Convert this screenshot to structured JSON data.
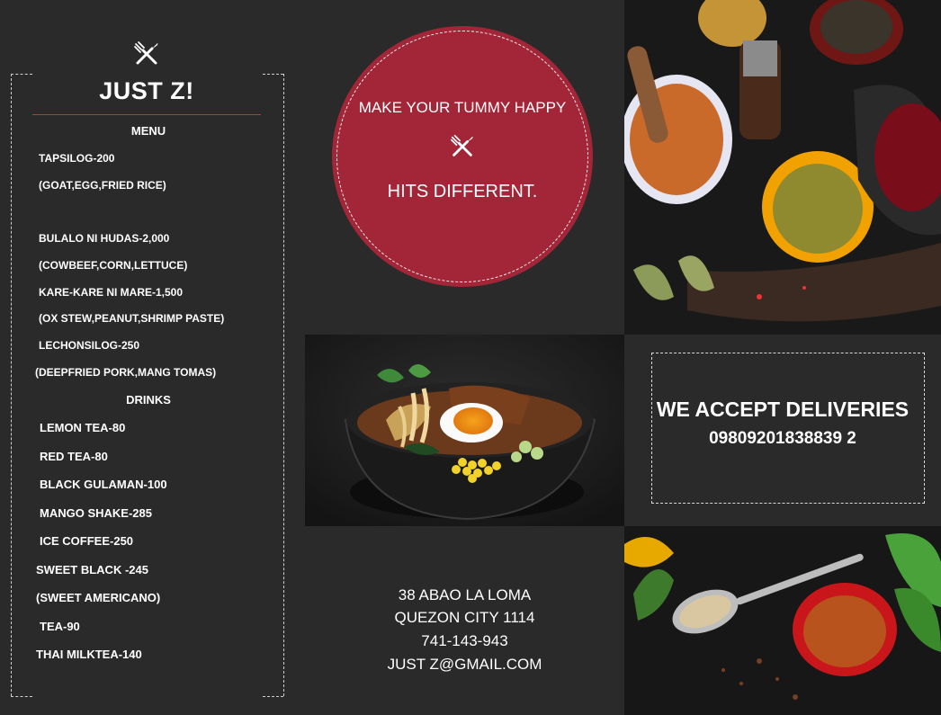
{
  "brand": {
    "name": "JUST Z!",
    "logo_icon": "fork-knife-icon"
  },
  "menu": {
    "heading": "MENU",
    "lines": [
      "TAPSILOG-200",
      "(GOAT,EGG,FRIED RICE)",
      "BULALO NI HUDAS-2,000",
      "(COWBEEF,CORN,LETTUCE)",
      "KARE-KARE NI MARE-1,500",
      "(OX STEW,PEANUT,SHRIMP PASTE)",
      "LECHONSILOG-250",
      "(DEEPFRIED PORK,MANG TOMAS)"
    ]
  },
  "drinks": {
    "heading": "DRINKS",
    "lines": [
      "LEMON TEA-80",
      "RED TEA-80",
      "BLACK GULAMAN-100",
      "MANGO SHAKE-285",
      "ICE COFFEE-250",
      "SWEET BLACK -245",
      "(SWEET AMERICANO)",
      "TEA-90",
      "THAI MILKTEA-140"
    ]
  },
  "promo": {
    "top_text": "MAKE YOUR TUMMY HAPPY",
    "bottom_text": "HITS DIFFERENT.",
    "icon": "fork-knife-icon",
    "color": "#a32638"
  },
  "address": {
    "lines": [
      "38 ABAO LA LOMA",
      "QUEZON CITY 1114",
      "741-143-943",
      "JUST Z@GMAIL.COM"
    ]
  },
  "delivery": {
    "title": "WE ACCEPT DELIVERIES",
    "phone": "09809201838839 2"
  },
  "colors": {
    "background": "#2a2a2a",
    "accent": "#a32638"
  }
}
